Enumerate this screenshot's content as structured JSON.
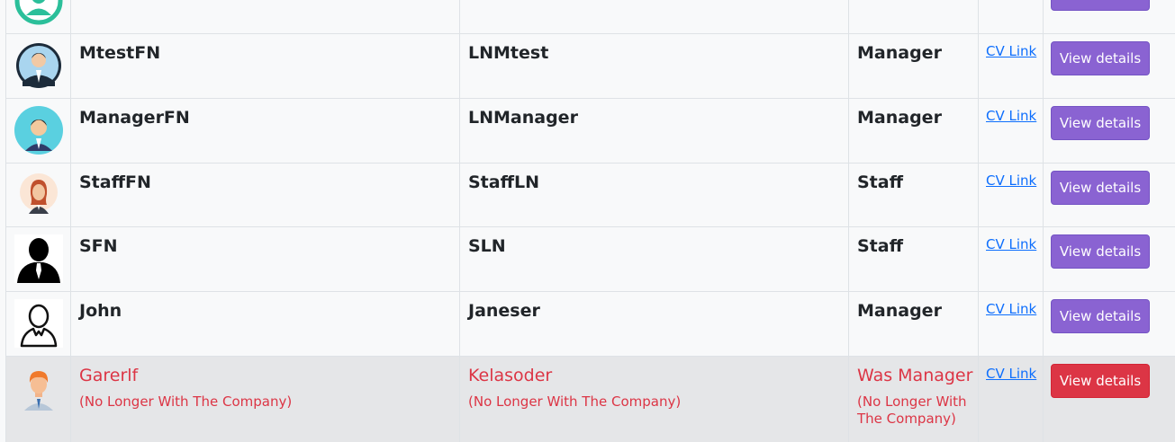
{
  "columns": [
    "avatar",
    "first_name",
    "last_name",
    "role",
    "cv",
    "action"
  ],
  "rows": [
    {
      "avatar": "partial-teal-avatar-icon",
      "first_name": "",
      "last_name": "",
      "role": "",
      "cv_link": "",
      "action_label": ""
    },
    {
      "avatar": "businessman-circle-avatar-icon",
      "first_name": "MtestFN",
      "last_name": "LNMtest",
      "role": "Manager",
      "cv_link": "CV Link",
      "action_label": "View details"
    },
    {
      "avatar": "manager-cyan-avatar-icon",
      "first_name": "ManagerFN",
      "last_name": "LNManager",
      "role": "Manager",
      "cv_link": "CV Link",
      "action_label": "View details"
    },
    {
      "avatar": "staff-woman-avatar-icon",
      "first_name": "StaffFN",
      "last_name": "StaffLN",
      "role": "Staff",
      "cv_link": "CV Link",
      "action_label": "View details"
    },
    {
      "avatar": "silhouette-tie-avatar-icon",
      "first_name": "SFN",
      "last_name": "SLN",
      "role": "Staff",
      "cv_link": "CV Link",
      "action_label": "View details"
    },
    {
      "avatar": "outline-person-avatar-icon",
      "first_name": "John",
      "last_name": "Janeser",
      "role": "Manager",
      "cv_link": "CV Link",
      "action_label": "View details"
    },
    {
      "avatar": "orange-hair-avatar-icon",
      "first_name": "Garerlf",
      "last_name": "Kelasoder",
      "role": "Was Manager",
      "cv_link": "CV Link",
      "action_label": "View details",
      "status_note": "(No Longer With The Company)"
    }
  ],
  "colors": {
    "primary_button": "#8a63d2",
    "danger": "#dc3545",
    "link": "#0d6efd",
    "inactive_row": "#e5e6e8"
  }
}
